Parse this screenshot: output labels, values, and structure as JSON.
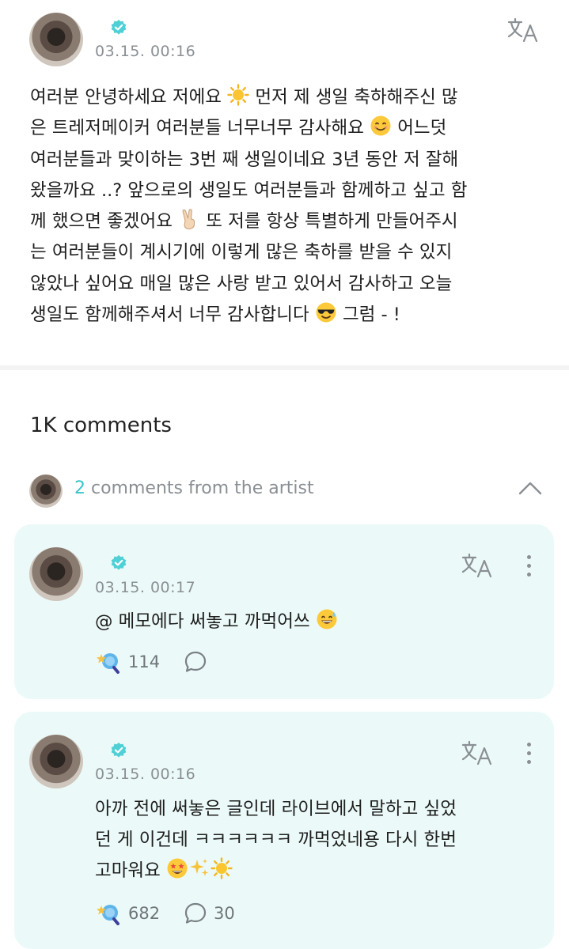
{
  "post": {
    "date": "03.15. 00:16",
    "lines": [
      "여러분 안녕하세요 저에요 ☀ 먼저 제 생일 축하해주신 많",
      "은 트레저메이커 여러분들 너무너무 감사해요 😊 어느덧",
      "여러분들과 맞이하는 3번 째 생일이네요 3년 동안 저 잘해",
      "왔을까요 ..? 앞으로의 생일도 여러분들과 함께하고 싶고 함",
      "께 했으면 좋겠어요 ✌ 또 저를 항상 특별하게 만들어주시",
      "는 여러분들이 계시기에 이렇게 많은 축하를 받을 수 있지",
      "않았나 싶어요 매일 많은 사랑 받고 있어서 감사하고 오늘",
      "생일도 함께해주셔서 너무 감사합니다 😎 그럼 - !"
    ],
    "segments": {
      "l1a": "여러분 안녕하세요 저에요 ",
      "l1b": " 먼저 제 생일 축하해주신 많",
      "l2a": "은 트레저메이커 여러분들 너무너무 감사해요 ",
      "l2b": " 어느덧",
      "l3": "여러분들과 맞이하는 3번 째 생일이네요 3년 동안 저 잘해",
      "l4": "왔을까요 ..? 앞으로의 생일도 여러분들과 함께하고 싶고 함",
      "l5a": "께 했으면 좋겠어요 ",
      "l5b": " 또 저를 항상 특별하게 만들어주시",
      "l6": "는 여러분들이 계시기에 이렇게 많은 축하를 받을 수 있지",
      "l7": "않았나 싶어요 매일 많은 사랑 받고 있어서 감사하고 오늘",
      "l8a": "생일도 함께해주셔서 너무 감사합니다 ",
      "l8b": " 그럼 - !"
    },
    "emojis": [
      "sun-emoji",
      "smiling-face-emoji",
      "victory-hand-emoji",
      "sunglasses-emoji"
    ]
  },
  "comments_header": {
    "count_label": "1K comments",
    "artist_count": "2",
    "artist_label": " comments from the artist"
  },
  "comments": [
    {
      "date": "03.15. 00:17",
      "text_a": "@   메모에다 써놓고 까먹어쓰 ",
      "text_emoji": "grinning-sweat-emoji",
      "likes": "114",
      "replies": ""
    },
    {
      "date": "03.15. 00:16",
      "line1": "아까 전에 써놓은 글인데 라이브에서 말하고 싶었",
      "line2": "던 게 이건데 ㅋㅋㅋㅋㅋㅋ 까먹었네용 다시 한번",
      "line3": "고마워요 ",
      "line3_emojis": [
        "star-struck-emoji",
        "sparkles-emoji",
        "sun-emoji"
      ],
      "likes": "682",
      "replies": "30"
    }
  ],
  "colors": {
    "accent": "#39c3c9",
    "card_bg": "#ebfaf8",
    "muted": "#8a8f94"
  },
  "icons": [
    "verified-badge-icon",
    "translate-icon",
    "chevron-up-icon",
    "more-options-icon",
    "like-light-stick-icon",
    "reply-bubble-icon"
  ]
}
